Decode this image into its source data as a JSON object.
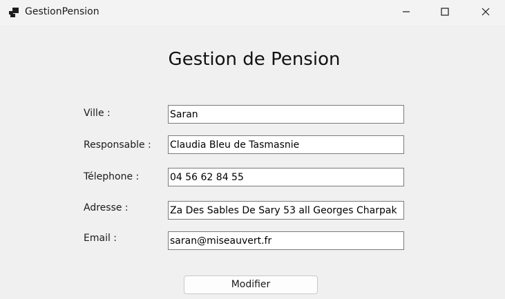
{
  "window": {
    "title": "GestionPension"
  },
  "form": {
    "heading": "Gestion de Pension",
    "fields": [
      {
        "label": "Ville :",
        "value": "Saran"
      },
      {
        "label": "Responsable :",
        "value": "Claudia Bleu de Tasmasnie"
      },
      {
        "label": "Télephone :",
        "value": "04 56 62 84 55"
      },
      {
        "label": "Adresse :",
        "value": "Za Des Sables De Sary 53 all Georges Charpak"
      },
      {
        "label": "Email :",
        "value": "saran@miseauvert.fr"
      }
    ],
    "submit_label": "Modifier"
  },
  "icons": {
    "app": "app-icon",
    "minimize": "minimize-icon",
    "maximize": "maximize-icon",
    "close": "close-icon"
  }
}
